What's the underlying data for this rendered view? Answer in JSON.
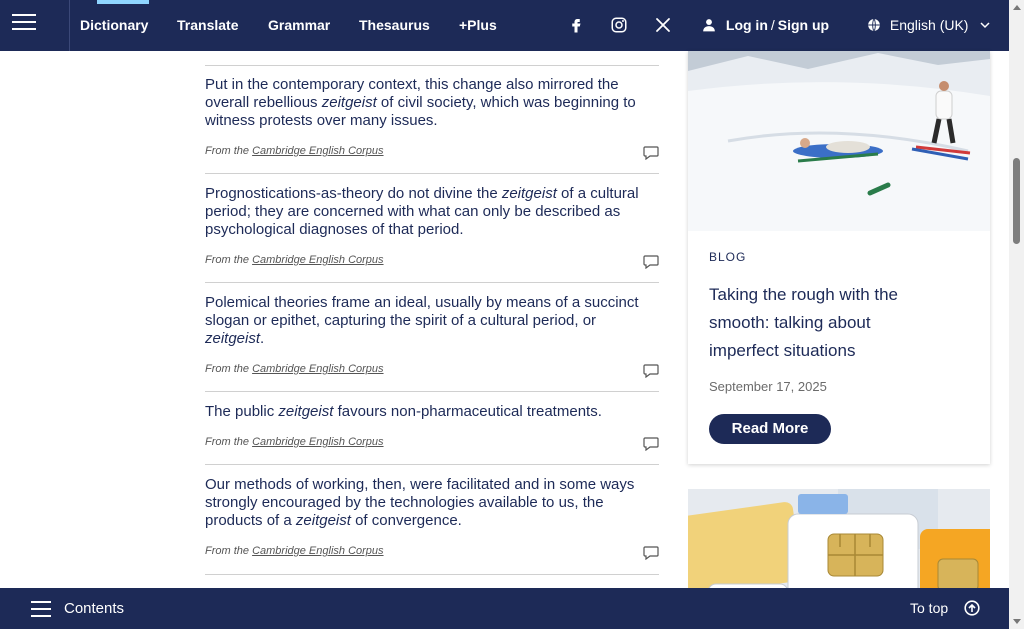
{
  "topnav": {
    "items": [
      {
        "label": "Dictionary"
      },
      {
        "label": "Translate"
      },
      {
        "label": "Grammar"
      },
      {
        "label": "Thesaurus"
      },
      {
        "label": "+Plus"
      }
    ],
    "login": "Log in",
    "separator": "/",
    "signup": "Sign up",
    "language": "English (UK)"
  },
  "examples": [
    {
      "html": "Put in the contemporary context, this change also mirrored the overall rebellious <em>zeitgeist</em> of civil society, which was beginning to witness protests over many issues.",
      "from": "From the",
      "source": "Cambridge English Corpus"
    },
    {
      "html": "Prognostications-as-theory do not divine the <em>zeitgeist</em> of a cultural period; they are concerned with what can only be described as psychological diagnoses of that period.",
      "from": "From the",
      "source": "Cambridge English Corpus"
    },
    {
      "html": "Polemical theories frame an ideal, usually by means of a succinct slogan or epithet, capturing the spirit of a cultural period, or <em>zeitgeist</em>.",
      "from": "From the",
      "source": "Cambridge English Corpus"
    },
    {
      "html": "The public <em>zeitgeist</em> favours non-pharmaceutical treatments.",
      "from": "From the",
      "source": "Cambridge English Corpus"
    },
    {
      "html": "Our methods of working, then, were facilitated and in some ways strongly encouraged by the technologies available to us, the products of a <em>zeitgeist</em> of convergence.",
      "from": "From the",
      "source": "Cambridge English Corpus"
    }
  ],
  "blog_card": {
    "label": "BLOG",
    "title": "Taking the rough with the smooth: talking about imperfect situations",
    "date": "September 17, 2025",
    "button": "Read More"
  },
  "bottombar": {
    "contents": "Contents",
    "totop": "To top"
  },
  "colors": {
    "navy": "#1d2a57",
    "accent": "#8fd5ff"
  }
}
